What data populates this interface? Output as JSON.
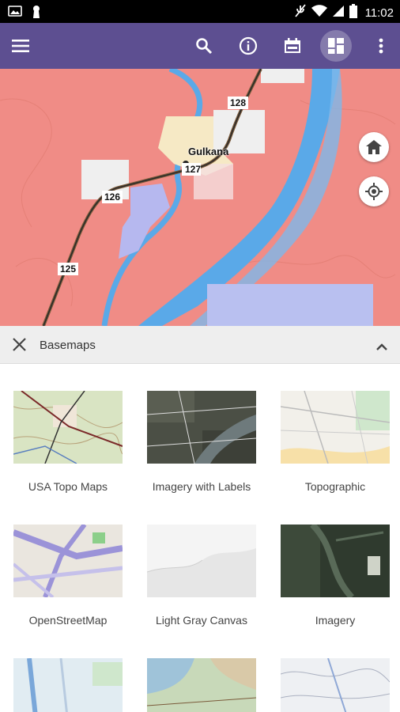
{
  "status_bar": {
    "time": "11:02"
  },
  "toolbar": {
    "menu_icon": "hamburger-menu-icon",
    "search_icon": "search-icon",
    "info_icon": "info-icon",
    "bookmarks_icon": "map-bookmarks-icon",
    "basemap_icon": "basemap-gallery-icon",
    "overflow_icon": "more-vert-icon"
  },
  "map": {
    "place_label": "Gulkana",
    "road_markers": [
      "128",
      "127",
      "126",
      "125"
    ],
    "home_icon": "home-icon",
    "locate_icon": "my-location-icon"
  },
  "panel": {
    "title": "Basemaps",
    "close_icon": "close-icon",
    "collapse_icon": "chevron-up-icon"
  },
  "basemaps": [
    {
      "label": "USA Topo Maps"
    },
    {
      "label": "Imagery with Labels"
    },
    {
      "label": "Topographic"
    },
    {
      "label": "OpenStreetMap"
    },
    {
      "label": "Light Gray Canvas"
    },
    {
      "label": "Imagery"
    }
  ],
  "colors": {
    "app_bar": "#5d4f91",
    "map_land": "#f08c86",
    "water": "#5aa9e8",
    "panel_header": "#eeeeee"
  }
}
